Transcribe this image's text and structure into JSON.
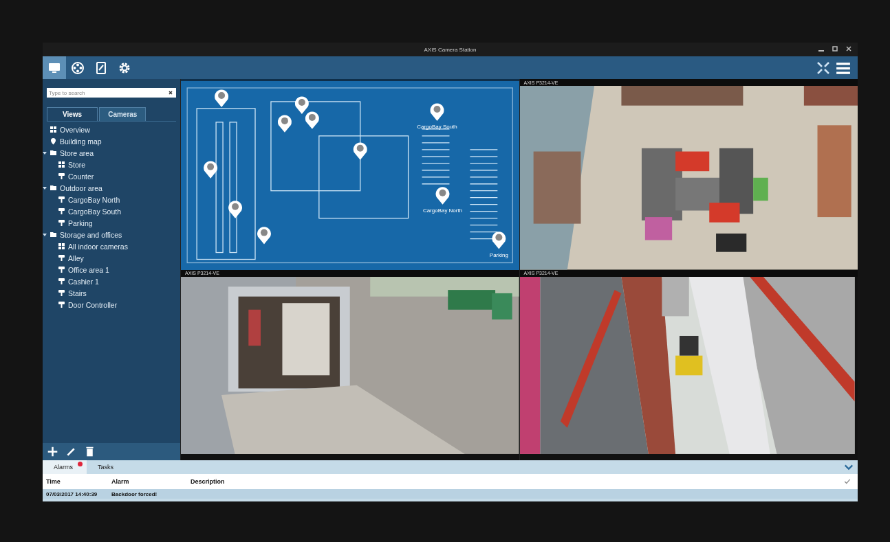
{
  "window": {
    "title": "AXIS Camera Station"
  },
  "toolbar": {
    "buttons": [
      {
        "kind": "live",
        "selected": true
      },
      {
        "kind": "playback",
        "selected": false
      },
      {
        "kind": "reports",
        "selected": false
      },
      {
        "kind": "settings",
        "selected": false
      }
    ]
  },
  "sidebar": {
    "search": {
      "placeholder": "Type to search"
    },
    "tabs": [
      {
        "label": "Views",
        "selected": true
      },
      {
        "label": "Cameras",
        "selected": false
      }
    ],
    "tree": [
      {
        "label": "Overview",
        "kind": "view"
      },
      {
        "label": "Building map",
        "kind": "map"
      },
      {
        "label": "Store area",
        "kind": "folder",
        "expanded": true,
        "children": [
          {
            "label": "Store",
            "kind": "view"
          },
          {
            "label": "Counter",
            "kind": "camera"
          }
        ]
      },
      {
        "label": "Outdoor area",
        "kind": "folder",
        "expanded": true,
        "children": [
          {
            "label": "CargoBay North",
            "kind": "camera"
          },
          {
            "label": "CargoBay South",
            "kind": "camera"
          },
          {
            "label": "Parking",
            "kind": "camera"
          }
        ]
      },
      {
        "label": "Storage and offices",
        "kind": "folder",
        "expanded": true,
        "children": [
          {
            "label": "All indoor cameras",
            "kind": "view"
          },
          {
            "label": "Alley",
            "kind": "camera"
          },
          {
            "label": "Office area 1",
            "kind": "camera"
          },
          {
            "label": "Cashier 1",
            "kind": "camera"
          },
          {
            "label": "Stairs",
            "kind": "camera"
          },
          {
            "label": "Door Controller",
            "kind": "camera"
          }
        ]
      }
    ]
  },
  "views": [
    {
      "kind": "map",
      "pins": [
        {
          "label": "CargoBay South"
        },
        {
          "label": "CargoBay North"
        },
        {
          "label": "Parking"
        }
      ]
    },
    {
      "kind": "camera",
      "label": "AXIS P3214-VE"
    },
    {
      "kind": "camera",
      "label": "AXIS P3214-VE"
    },
    {
      "kind": "camera",
      "label": "AXIS P3214-VE"
    }
  ],
  "alarms": {
    "tabs": [
      {
        "label": "Alarms",
        "selected": true,
        "alert": true
      },
      {
        "label": "Tasks",
        "selected": false
      }
    ],
    "columns": [
      "Time",
      "Alarm",
      "Description"
    ],
    "rows": [
      {
        "time": "07/03/2017 14:40:39",
        "alarm": "Backdoor forced!"
      }
    ]
  }
}
